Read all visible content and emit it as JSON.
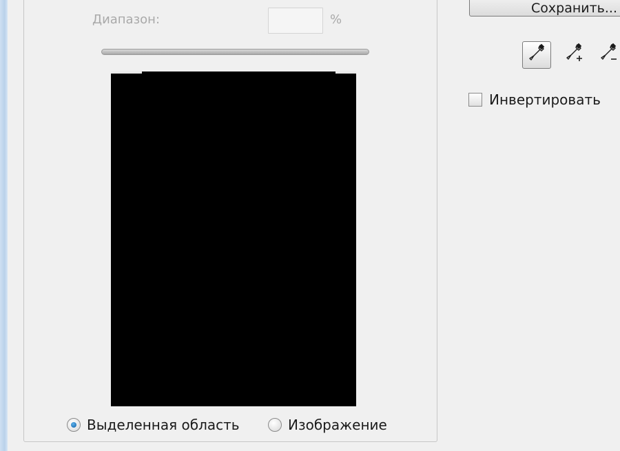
{
  "range": {
    "label": "Диапазон:",
    "value": "",
    "unit": "%"
  },
  "preview": {
    "mode_options": [
      {
        "label": "Выделенная область",
        "selected": true
      },
      {
        "label": "Изображение",
        "selected": false
      }
    ]
  },
  "toolbar": {
    "save_label": "Сохранить...",
    "tools": [
      "eyedropper-icon",
      "eyedropper-plus-icon",
      "eyedropper-minus-icon"
    ],
    "active_tool": "eyedropper-icon"
  },
  "invert": {
    "label": "Инвертировать",
    "checked": false
  },
  "colors": {
    "background": "#f0f0f0",
    "preview": "#000000",
    "radio_accent": "#0b5ea8"
  }
}
